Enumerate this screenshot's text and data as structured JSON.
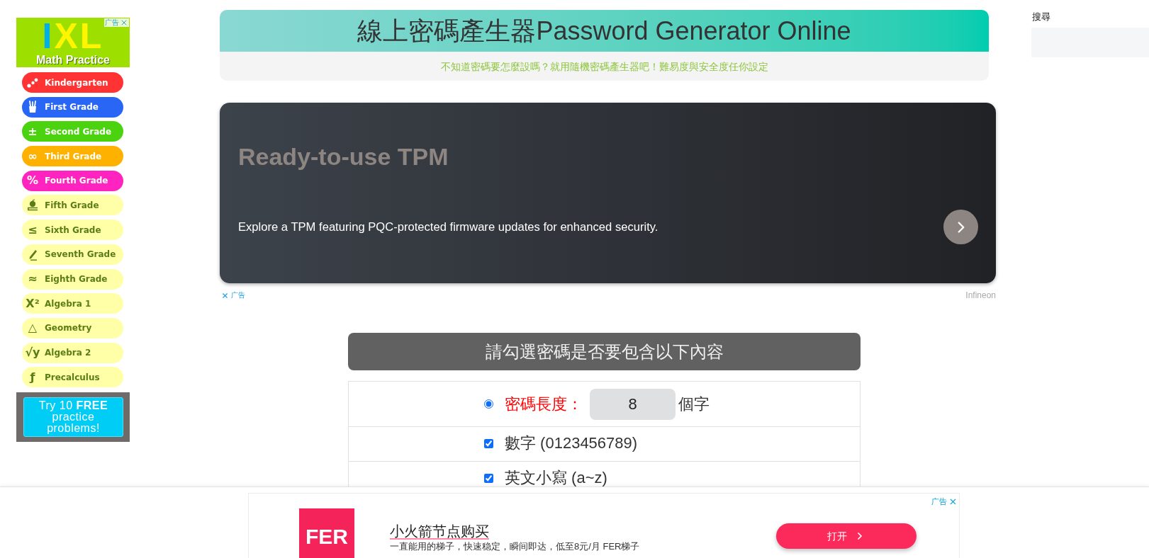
{
  "left_ad": {
    "logo": "IXL",
    "tagline": "Math Practice",
    "ad_label": "广告",
    "grades": [
      {
        "label": "Kindergarten",
        "color": "#ff3333"
      },
      {
        "label": "First Grade",
        "color": "#2a66f5"
      },
      {
        "label": "Second Grade",
        "color": "#4bd30f",
        "symbol": "±"
      },
      {
        "label": "Third Grade",
        "color": "#ffb100",
        "symbol": "∞"
      },
      {
        "label": "Fourth Grade",
        "color": "#ff24bf",
        "symbol": "%"
      },
      {
        "label": "Fifth Grade",
        "color": "#ffffa8"
      },
      {
        "label": "Sixth Grade",
        "color": "#ffffa8",
        "symbol": "≤"
      },
      {
        "label": "Seventh Grade",
        "color": "#ffffa8"
      },
      {
        "label": "Eighth Grade",
        "color": "#ffffa8",
        "symbol": "≈"
      },
      {
        "label": "Algebra 1",
        "color": "#ffffa8",
        "symbol": "X²"
      },
      {
        "label": "Geometry",
        "color": "#ffffa8",
        "symbol": "△"
      },
      {
        "label": "Algebra 2",
        "color": "#ffffa8",
        "symbol": "√y"
      },
      {
        "label": "Precalculus",
        "color": "#ffffa8",
        "symbol": "ƒ"
      }
    ],
    "cta": "Try 10 **FREE** practice problems!"
  },
  "header": {
    "title": "線上密碼產生器Password Generator Online",
    "subtitle": "不知道密碼要怎麼設嗎？就用隨機密碼產生器吧！難易度與安全度任你設定"
  },
  "banner_ad": {
    "title": "Ready-to-use TPM",
    "description": "Explore a TPM featuring PQC-protected firmware updates for enhanced security.",
    "ad_label": "广告",
    "advertiser": "Infineon"
  },
  "options": {
    "heading": "請勾選密碼是否要包含以下內容",
    "length": {
      "selected": true,
      "label": "密碼長度：",
      "value": "8",
      "unit": "個字"
    },
    "items": [
      {
        "label": "數字 (0123456789)",
        "checked": true
      },
      {
        "label": "英文小寫 (a~z)",
        "checked": true
      }
    ]
  },
  "sidebar": {
    "search_label": "搜尋"
  },
  "bottom_ad": {
    "logo": "FER",
    "title": "小火箭节点购买",
    "description": "一直能用的梯子，快速稳定，瞬间即达，低至8元/月 FER梯子",
    "button": "打开",
    "ad_label": "广告"
  }
}
